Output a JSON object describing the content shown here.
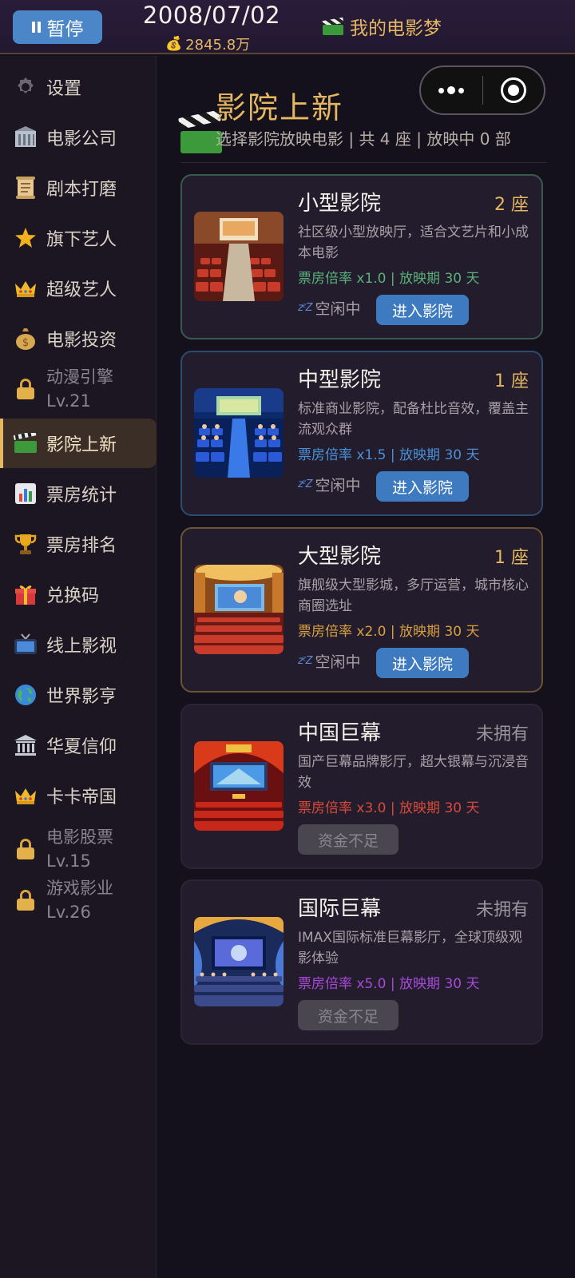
{
  "topbar": {
    "pause_label": "暂停",
    "date": "2008/07/02",
    "money": "2845.8万",
    "game_title": "我的电影梦"
  },
  "sidebar": {
    "items": [
      {
        "label": "设置",
        "icon": "gear-icon"
      },
      {
        "label": "电影公司",
        "icon": "building-icon"
      },
      {
        "label": "剧本打磨",
        "icon": "scroll-icon"
      },
      {
        "label": "旗下艺人",
        "icon": "star-icon"
      },
      {
        "label": "超级艺人",
        "icon": "crown-icon"
      },
      {
        "label": "电影投资",
        "icon": "money-bag-icon"
      },
      {
        "label": "动漫引擎",
        "level": "Lv.21",
        "locked": true,
        "icon": "lock-icon"
      },
      {
        "label": "影院上新",
        "icon": "clapperboard-icon",
        "active": true
      },
      {
        "label": "票房统计",
        "icon": "bar-chart-icon"
      },
      {
        "label": "票房排名",
        "icon": "trophy-icon"
      },
      {
        "label": "兑换码",
        "icon": "gift-icon"
      },
      {
        "label": "线上影视",
        "icon": "tv-icon"
      },
      {
        "label": "世界影亨",
        "icon": "globe-icon"
      },
      {
        "label": "华夏信仰",
        "icon": "temple-icon"
      },
      {
        "label": "卡卡帝国",
        "icon": "crown-icon"
      },
      {
        "label": "电影股票",
        "level": "Lv.15",
        "locked": true,
        "icon": "lock-icon"
      },
      {
        "label": "游戏影业",
        "level": "Lv.26",
        "locked": true,
        "icon": "lock-icon"
      }
    ]
  },
  "main": {
    "title": "影院上新",
    "subtitle": "选择影院放映电影 | 共 4 座 | 放映中 0 部",
    "cinemas": [
      {
        "name": "小型影院",
        "count": "2 座",
        "desc": "社区级小型放映厅，适合文艺片和小成本电影",
        "rate": "票房倍率 x1.0 | 放映期 30 天",
        "status": "空闲中",
        "action": "进入影院",
        "rate_color": "#59b27a"
      },
      {
        "name": "中型影院",
        "count": "1 座",
        "desc": "标准商业影院，配备杜比音效，覆盖主流观众群",
        "rate": "票房倍率 x1.5 | 放映期 30 天",
        "status": "空闲中",
        "action": "进入影院",
        "rate_color": "#4a90d8"
      },
      {
        "name": "大型影院",
        "count": "1 座",
        "desc": "旗舰级大型影城，多厅运营，城市核心商圈选址",
        "rate": "票房倍率 x2.0 | 放映期 30 天",
        "status": "空闲中",
        "action": "进入影院",
        "rate_color": "#d8a040"
      },
      {
        "name": "中国巨幕",
        "count": "未拥有",
        "desc": "国产巨幕品牌影厅，超大银幕与沉浸音效",
        "rate": "票房倍率 x3.0 | 放映期 30 天",
        "action": "资金不足",
        "rate_color": "#d84a3a"
      },
      {
        "name": "国际巨幕",
        "count": "未拥有",
        "desc": "IMAX国际标准巨幕影厅，全球顶级观影体验",
        "rate": "票房倍率 x5.0 | 放映期 30 天",
        "action": "资金不足",
        "rate_color": "#a84ad8"
      }
    ]
  },
  "colors": {
    "accent_gold": "#e4b760",
    "button_blue": "#3e7ac0",
    "background": "#14101c"
  }
}
